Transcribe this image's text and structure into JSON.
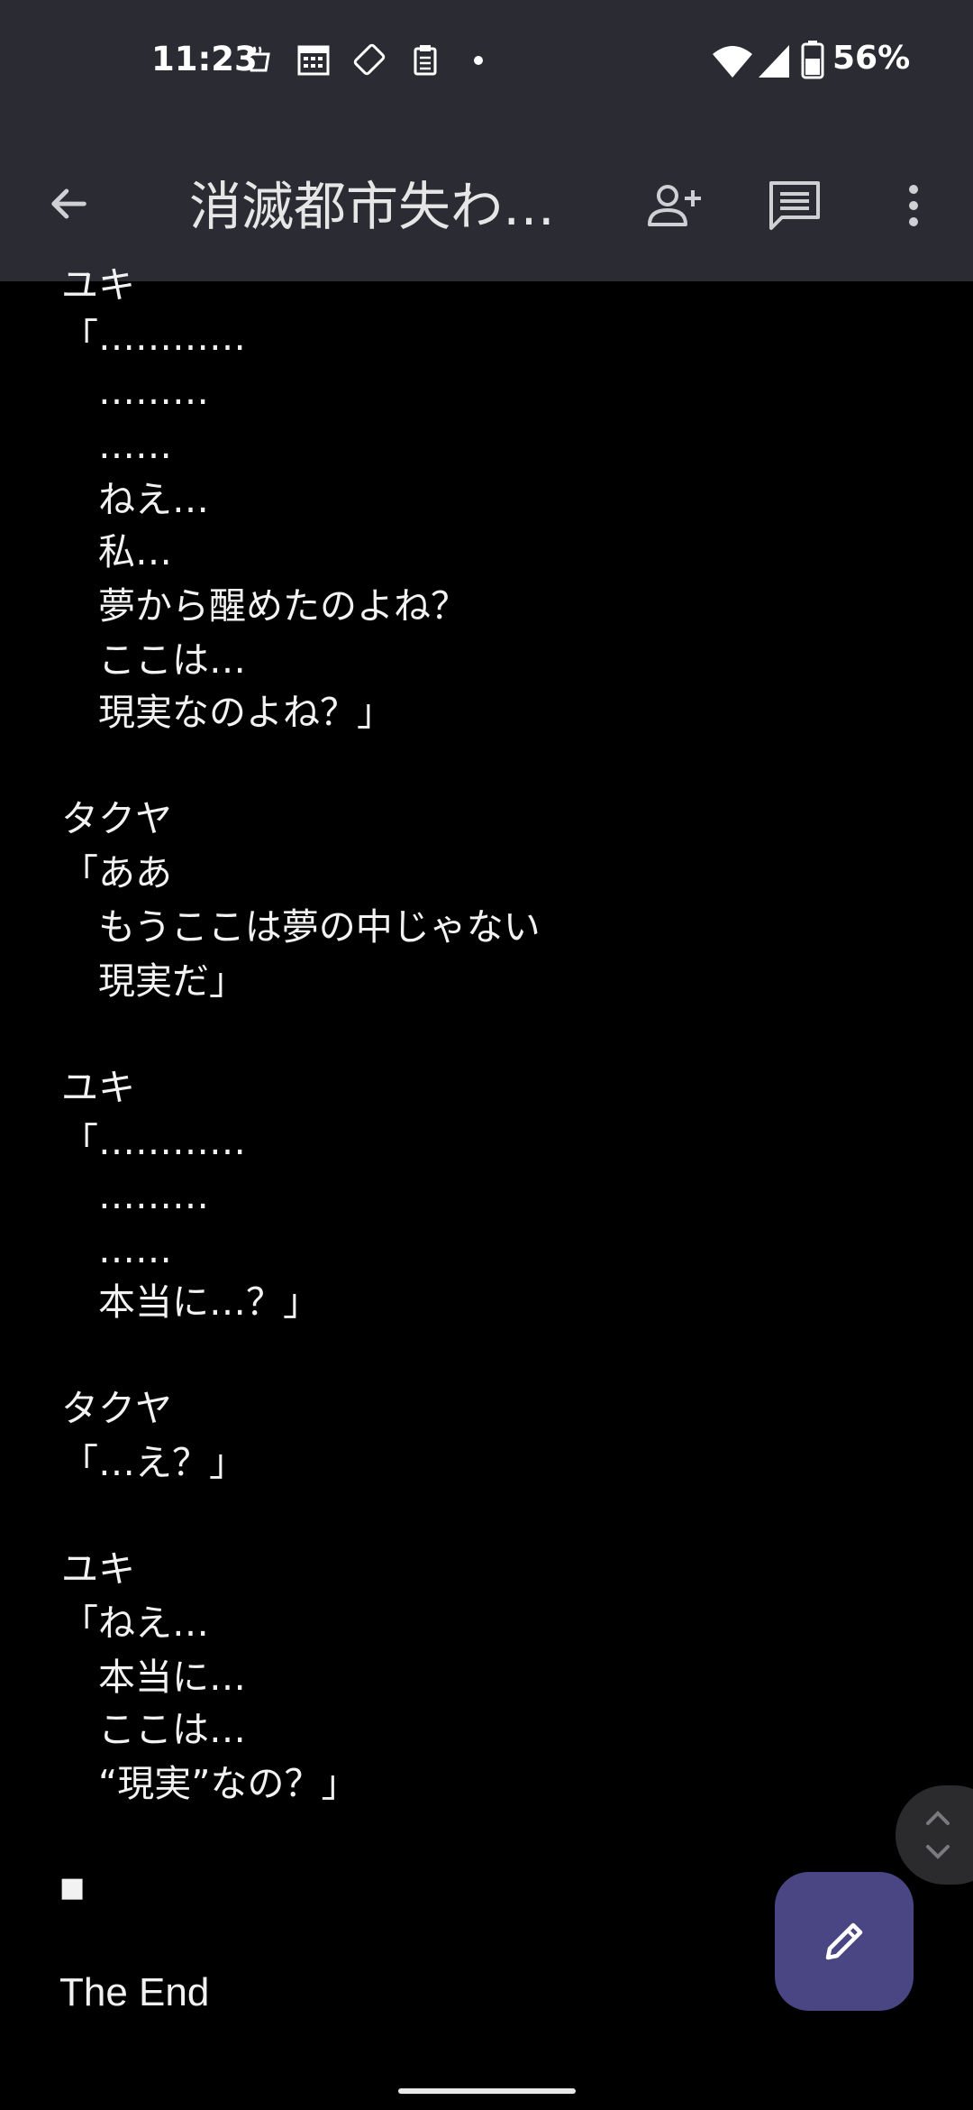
{
  "status_bar": {
    "time": "11:23",
    "battery": "56%"
  },
  "app_bar": {
    "title": "消滅都市失わ…",
    "icons": [
      "back-arrow-icon",
      "add-person-icon",
      "comment-icon",
      "more-vert-icon"
    ]
  },
  "document": {
    "lines": [
      "ユキ",
      "「…………",
      "　………",
      "　……",
      "　ねえ…",
      "　私…",
      "　夢から醒めたのよね？",
      "　ここは…",
      "　現実なのよね？」",
      "",
      "タクヤ",
      "「ああ",
      "　もうここは夢の中じゃない",
      "　現実だ」",
      "",
      "ユキ",
      "「…………",
      "　………",
      "　……",
      "　本当に…？」",
      "",
      "タクヤ",
      "「…え？」",
      "",
      "ユキ",
      "「ねえ…",
      "　本当に…",
      "　ここは…",
      "　“現実”なの？」",
      "",
      "■",
      "",
      "The End"
    ]
  },
  "fab": {
    "icon": "edit-pencil-icon"
  },
  "colors": {
    "bar_background": "#2b2b33",
    "page_background": "#000000",
    "fab": "#4a4683"
  }
}
